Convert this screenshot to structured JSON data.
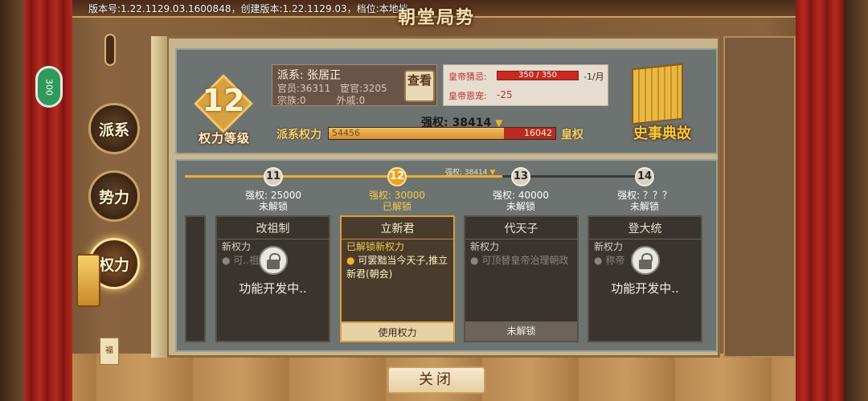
{
  "header": {
    "version_text": "版本号:1.22.1129.03.1600848，创建版本:1.22.1129.03，档位:本地档",
    "title": "朝堂局势"
  },
  "side_nav": {
    "tabs": [
      {
        "label": "派系",
        "active": false
      },
      {
        "label": "势力",
        "active": false
      },
      {
        "label": "权力",
        "active": true
      }
    ],
    "chip_label": "300",
    "tag_label": "福"
  },
  "rank": {
    "level": "12",
    "label": "权力等级"
  },
  "faction": {
    "name_label": "派系:",
    "name": "张居正",
    "officials_label": "官员:",
    "officials": "36311",
    "eunuchs_label": "宦官:",
    "eunuchs": "3205",
    "clan_label": "宗族:",
    "clan": "0",
    "inlaws_label": "外戚:",
    "inlaws": "0",
    "view_button": "查看"
  },
  "emperor": {
    "suspicion_label": "皇帝猜忌:",
    "suspicion_value": "350 / 350",
    "suspicion_fraction": 1.0,
    "suspicion_trend": "-1/月",
    "favor_label": "皇帝恩宠:",
    "favor_value": "-25"
  },
  "power": {
    "strong_label": "强权:",
    "strong_value": "38414",
    "left_label": "派系权力",
    "right_label": "皇权",
    "faction_power": "54456",
    "imperial_power": "16042",
    "faction_fraction": 0.7725
  },
  "history_book": {
    "label": "史事典故"
  },
  "timeline": {
    "marker_text": "强权: 38414",
    "nodes": [
      {
        "level": "11",
        "requirement": "强权: 25000",
        "state": "未解锁",
        "active": false
      },
      {
        "level": "12",
        "requirement": "强权: 30000",
        "state": "已解锁",
        "active": true
      },
      {
        "level": "13",
        "requirement": "强权: 40000",
        "state": "未解锁",
        "active": false
      },
      {
        "level": "14",
        "requirement": "强权: ？？？",
        "state": "未解锁",
        "active": false
      }
    ]
  },
  "cards": [
    {
      "title": "改祖制",
      "sub": "新权力",
      "desc": "可..祖制条例",
      "locked_overlay": "功能开发中..",
      "button": ""
    },
    {
      "title": "立新君",
      "sub": "已解锁新权力",
      "desc": "可罢黜当今天子,推立新君(朝会)",
      "locked_overlay": "",
      "button": "使用权力"
    },
    {
      "title": "代天子",
      "sub": "新权力",
      "desc": "可顶替皇帝治理朝政",
      "locked_overlay": "",
      "button": "未解锁"
    },
    {
      "title": "登大统",
      "sub": "新权力",
      "desc": "称帝",
      "locked_overlay": "功能开发中..",
      "button": ""
    }
  ],
  "footer": {
    "close_label": "关闭"
  }
}
